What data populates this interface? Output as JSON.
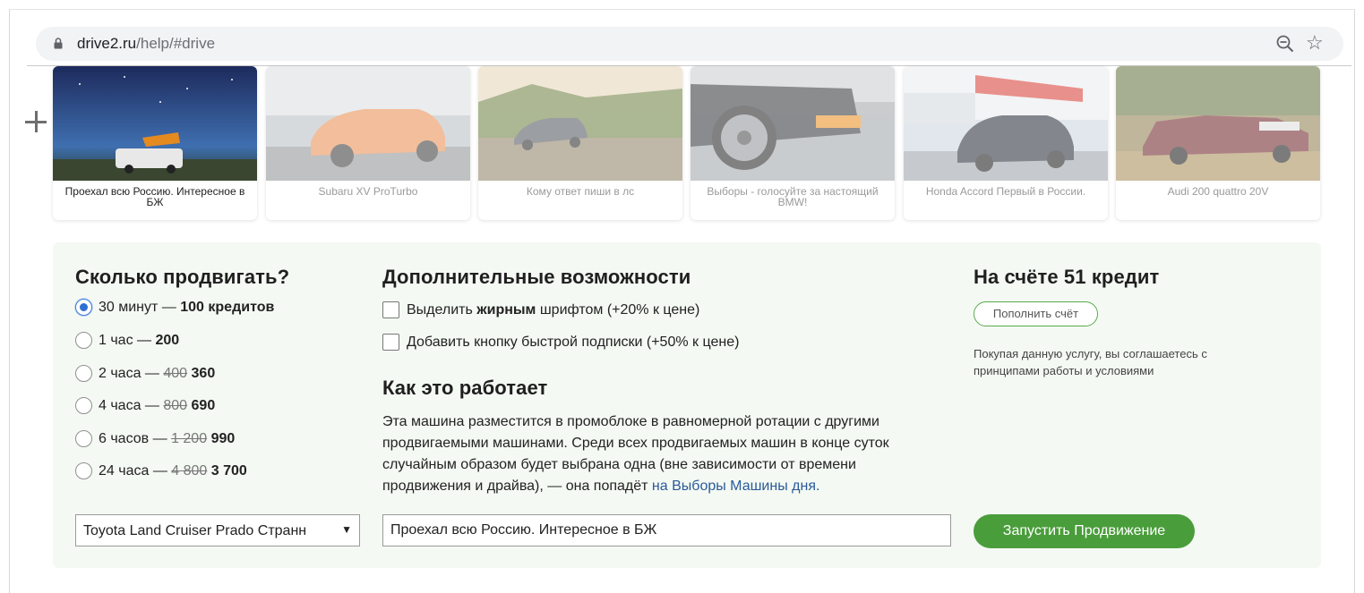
{
  "browser": {
    "url_host": "drive2.ru",
    "url_path": "/help/#drive",
    "icons": {
      "lock": "lock-icon",
      "zoom": "zoom-out-icon",
      "bookmark": "star-icon",
      "add": "plus-icon"
    }
  },
  "promo_cards": [
    {
      "caption": "Проехал всю Россию. Интересное в БЖ",
      "active": true
    },
    {
      "caption": "Subaru XV ProTurbo",
      "active": false
    },
    {
      "caption": "Кому ответ пиши в лс",
      "active": false
    },
    {
      "caption": "Выборы - голосуйте за настоящий BMW!",
      "active": false
    },
    {
      "caption": "Honda Accord Первый в России.",
      "active": false
    },
    {
      "caption": "Audi 200 quattro 20V",
      "active": false
    }
  ],
  "duration": {
    "title": "Сколько продвигать?",
    "options": [
      {
        "label": "30 минут —",
        "old": "",
        "price": "100 кредитов",
        "checked": true
      },
      {
        "label": "1 час —",
        "old": "",
        "price": "200",
        "checked": false
      },
      {
        "label": "2 часа —",
        "old": "400",
        "price": "360",
        "checked": false
      },
      {
        "label": "4 часа —",
        "old": "800",
        "price": "690",
        "checked": false
      },
      {
        "label": "6 часов —",
        "old": "1 200",
        "price": "990",
        "checked": false
      },
      {
        "label": "24 часа —",
        "old": "4 800",
        "price": "3 700",
        "checked": false
      }
    ]
  },
  "extras": {
    "title": "Дополнительные возможности",
    "bold_option": {
      "before": "Выделить ",
      "bold": "жирным",
      "after": " шрифтом (+20% к цене)",
      "checked": false
    },
    "subscribe_option": {
      "label": "Добавить кнопку быстрой подписки (+50% к цене)",
      "checked": false
    }
  },
  "how": {
    "title": "Как это работает",
    "text": "Эта машина разместится в промоблоке в равномерной ротации с другими продвигаемыми машинами. Среди всех продвигаемых машин в конце суток случайным образом будет выбрана одна (вне зависимости от времени продвижения и драйва), — она попадёт ",
    "link": "на Выборы Машины дня."
  },
  "account": {
    "title": "На счёте 51 кредит",
    "topup_label": "Пополнить счёт",
    "note": "Покупая данную услугу, вы соглашаетесь с принципами работы и условиями"
  },
  "form": {
    "car_select": "Toyota Land Cruiser Prado Странн",
    "text_value": "Проехал всю Россию. Интересное в БЖ",
    "submit_label": "Запустить Продвижение"
  },
  "colors": {
    "accent_green": "#4a9d3b",
    "panel_bg": "#f4f9f3",
    "link": "#2a5a9a",
    "radio_checked": "#2f6fd0"
  }
}
